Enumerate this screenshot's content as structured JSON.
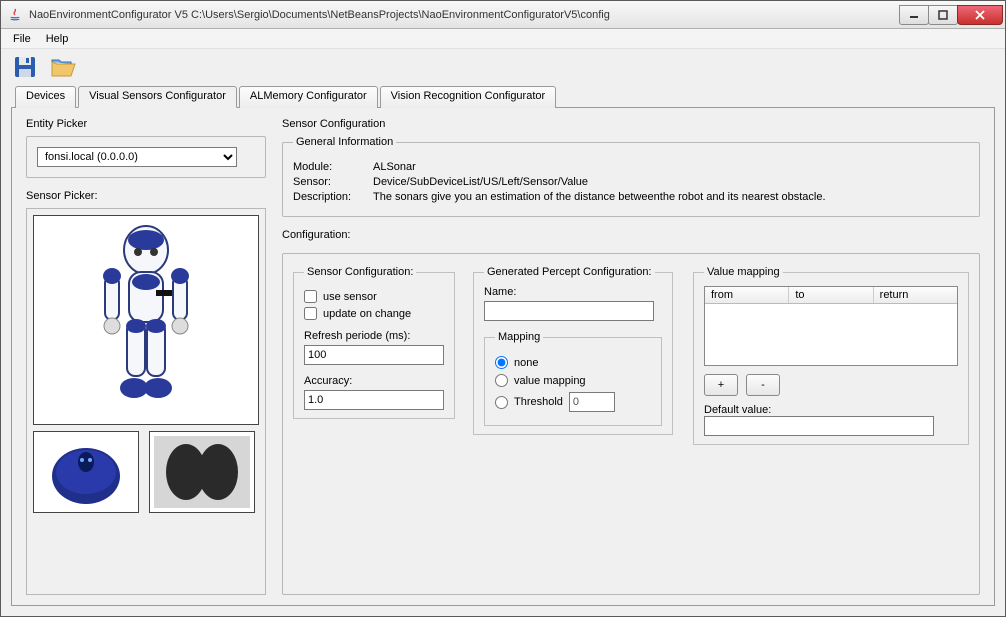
{
  "window": {
    "title": "NaoEnvironmentConfigurator V5 C:\\Users\\Sergio\\Documents\\NetBeansProjects\\NaoEnvironmentConfiguratorV5\\config"
  },
  "menu": {
    "file": "File",
    "help": "Help"
  },
  "toolbar": {
    "save_icon": "save-icon",
    "open_icon": "open-icon"
  },
  "tabs": {
    "devices": "Devices",
    "visual_sensors": "Visual Sensors Configurator",
    "almemory": "ALMemory Configurator",
    "vision": "Vision Recognition Configurator",
    "active": "visual_sensors"
  },
  "entity_picker": {
    "label": "Entity Picker",
    "selected": "fonsi.local (0.0.0.0)"
  },
  "sensor_picker": {
    "label": "Sensor Picker:"
  },
  "sensor_config": {
    "title": "Sensor Configuration",
    "general_info": {
      "legend": "General Information",
      "module_label": "Module:",
      "module_value": "ALSonar",
      "sensor_label": "Sensor:",
      "sensor_value": "Device/SubDeviceList/US/Left/Sensor/Value",
      "description_label": "Description:",
      "description_value": "The sonars give you an estimation of the distance betweenthe robot and its nearest obstacle."
    },
    "config": {
      "label": "Configuration:",
      "sensor_cfg": {
        "legend": "Sensor Configuration:",
        "use_sensor": "use sensor",
        "update_on_change": "update on change",
        "refresh_label": "Refresh periode (ms):",
        "refresh_value": "100",
        "accuracy_label": "Accuracy:",
        "accuracy_value": "1.0"
      },
      "percept": {
        "legend": "Generated Percept Configuration:",
        "name_label": "Name:",
        "name_value": "",
        "mapping_legend": "Mapping",
        "none": "none",
        "value_mapping": "value mapping",
        "threshold": "Threshold",
        "threshold_value": "0",
        "selected_mapping": "none"
      },
      "value_mapping": {
        "legend": "Value mapping",
        "col_from": "from",
        "col_to": "to",
        "col_return": "return",
        "add_btn": "+",
        "remove_btn": "-",
        "default_label": "Default value:",
        "default_value": ""
      }
    }
  }
}
